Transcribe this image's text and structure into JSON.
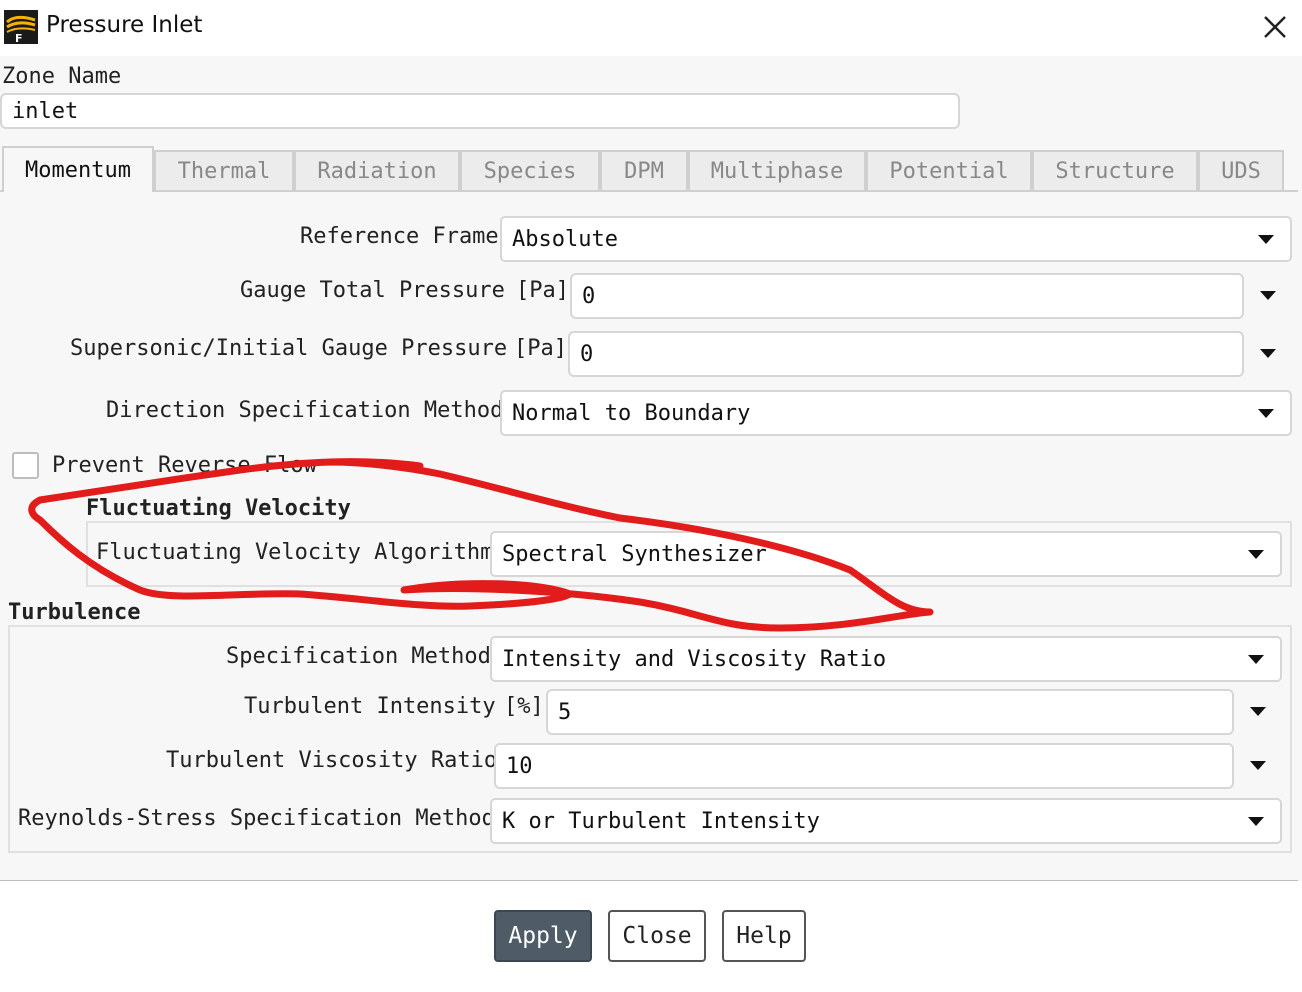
{
  "window": {
    "title": "Pressure Inlet",
    "close_glyph": "✕",
    "icon": "fluent-app-icon"
  },
  "zone": {
    "label": "Zone Name",
    "value": "inlet"
  },
  "tabs": [
    {
      "label": "Momentum",
      "active": true
    },
    {
      "label": "Thermal",
      "active": false
    },
    {
      "label": "Radiation",
      "active": false
    },
    {
      "label": "Species",
      "active": false
    },
    {
      "label": "DPM",
      "active": false
    },
    {
      "label": "Multiphase",
      "active": false
    },
    {
      "label": "Potential",
      "active": false
    },
    {
      "label": "Structure",
      "active": false
    },
    {
      "label": "UDS",
      "active": false
    }
  ],
  "momentum": {
    "reference_frame": {
      "label": "Reference Frame",
      "value": "Absolute"
    },
    "gauge_total_pressure": {
      "label": "Gauge Total Pressure",
      "unit": "[Pa]",
      "value": "0"
    },
    "supersonic_pressure": {
      "label": "Supersonic/Initial Gauge Pressure",
      "unit": "[Pa]",
      "value": "0"
    },
    "direction_method": {
      "label": "Direction Specification Method",
      "value": "Normal to Boundary"
    },
    "prevent_reverse_flow": {
      "label": "Prevent Reverse Flow",
      "checked": false
    },
    "fluctuating": {
      "title": "Fluctuating Velocity",
      "algorithm_label": "Fluctuating Velocity Algorithm",
      "algorithm_value": "Spectral Synthesizer"
    },
    "turbulence": {
      "title": "Turbulence",
      "spec_method": {
        "label": "Specification Method",
        "value": "Intensity and Viscosity Ratio"
      },
      "intensity": {
        "label": "Turbulent Intensity",
        "unit": "[%]",
        "value": "5"
      },
      "viscosity_ratio": {
        "label": "Turbulent Viscosity Ratio",
        "value": "10"
      },
      "reynolds_method": {
        "label": "Reynolds-Stress Specification Method",
        "value": "K or Turbulent Intensity"
      }
    }
  },
  "buttons": {
    "apply": "Apply",
    "close": "Close",
    "help": "Help"
  },
  "colors": {
    "annotation": "#e21b1b",
    "primary_button": "#4f5b66"
  }
}
